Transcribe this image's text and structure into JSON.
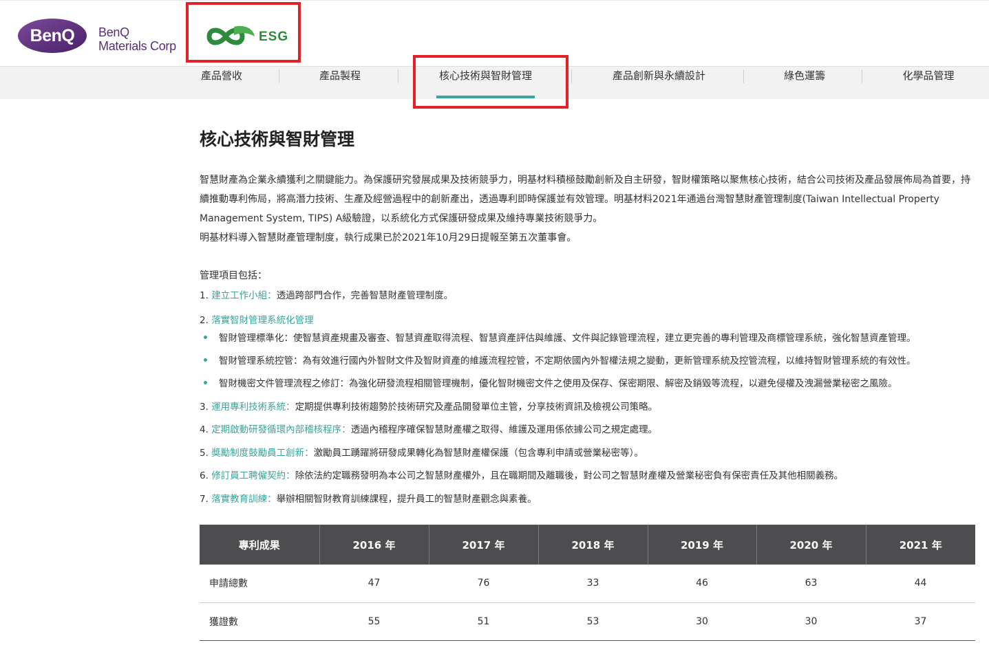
{
  "header": {
    "brand_line1": "BenQ",
    "brand_line2": "Materials Corp",
    "esg_label": "ESG",
    "colors": {
      "benq_purple": "#5a2d7a",
      "esg_green": "#2e8b3e",
      "highlight_red": "#e4212a"
    }
  },
  "nav": {
    "items": [
      {
        "label": "產品營收"
      },
      {
        "label": "產品製程"
      },
      {
        "label": "核心技術與智財管理"
      },
      {
        "label": "產品創新與永續設計"
      },
      {
        "label": "綠色運籌"
      },
      {
        "label": "化學品管理"
      }
    ],
    "active_index": 2,
    "accent_color": "#3aa49a"
  },
  "content": {
    "title": "核心技術與智財管理",
    "intro": [
      "智慧財產為企業永續獲利之關鍵能力。為保護研究發展成果及技術競爭力，明基材料積極鼓勵創新及自主研發，智財權策略以聚焦核心技術，結合公司技術及產品發展佈局為首要，持續推動專利佈局，將高潛力技術、生產及經營過程中的創新產出，透過專利即時保護並有效管理。明基材料2021年通過台灣智慧財產管理制度(Taiwan Intellectual Property Management System, TIPS) A級驗證，以系統化方式保護研發成果及維持專業技術競爭力。",
      "明基材料導入智慧財產管理制度，執行成果已於2021年10月29日提報至第五次董事會。"
    ],
    "mgmt_heading": "管理項目包括：",
    "items": [
      {
        "num": "1.",
        "title": "建立工作小組：",
        "desc": "透過跨部門合作，完善智慧財產管理制度。"
      },
      {
        "num": "2.",
        "title": "落實智財管理系統化管理",
        "desc": ""
      },
      {
        "num": "3.",
        "title": "運用專利技術系統：",
        "desc": "定期提供專利技術趨勢於技術研究及產品開發單位主管，分享技術資訊及檢視公司策略。"
      },
      {
        "num": "4.",
        "title": "定期啟動研發循環內部稽核程序：",
        "desc": "透過內稽程序確保智慧財產權之取得、維護及運用係依據公司之規定處理。"
      },
      {
        "num": "5.",
        "title": "獎勵制度鼓勵員工創新：",
        "desc": "激勵員工踴躍將研發成果轉化為智慧財產權保護（包含專利申請或營業秘密等）。"
      },
      {
        "num": "6.",
        "title": "修訂員工聘僱契約：",
        "desc": "除依法約定職務發明為本公司之智慧財產權外，且在職期間及離職後，對公司之智慧財產權及營業秘密負有保密責任及其他相關義務。"
      },
      {
        "num": "7.",
        "title": "落實教育訓練：",
        "desc": "舉辦相關智財教育訓練課程，提升員工的智慧財產觀念與素養。"
      }
    ],
    "sub_items": [
      "智財管理標準化：使智慧資產規畫及審查、智慧資產取得流程、智慧資產評估與維護、文件與記錄管理流程，建立更完善的專利管理及商標管理系統，強化智慧資產管理。",
      "智財管理系統控管：為有效進行國內外智財文件及智財資產的維護流程控管，不定期依國內外智權法規之變動，更新管理系統及控管流程，以維持智財管理系統的有效性。",
      "智財機密文件管理流程之修訂：為強化研發流程相關管理機制，優化智財機密文件之使用及保存、保密期限、解密及銷毀等流程，以避免侵權及洩漏營業秘密之風險。"
    ]
  },
  "table": {
    "headers": [
      "專利成果",
      "2016 年",
      "2017 年",
      "2018 年",
      "2019 年",
      "2020 年",
      "2021 年"
    ],
    "rows": [
      {
        "label": "申請總數",
        "values": [
          "47",
          "76",
          "33",
          "46",
          "63",
          "44"
        ]
      },
      {
        "label": "獲證數",
        "values": [
          "55",
          "51",
          "53",
          "30",
          "30",
          "37"
        ]
      }
    ]
  }
}
